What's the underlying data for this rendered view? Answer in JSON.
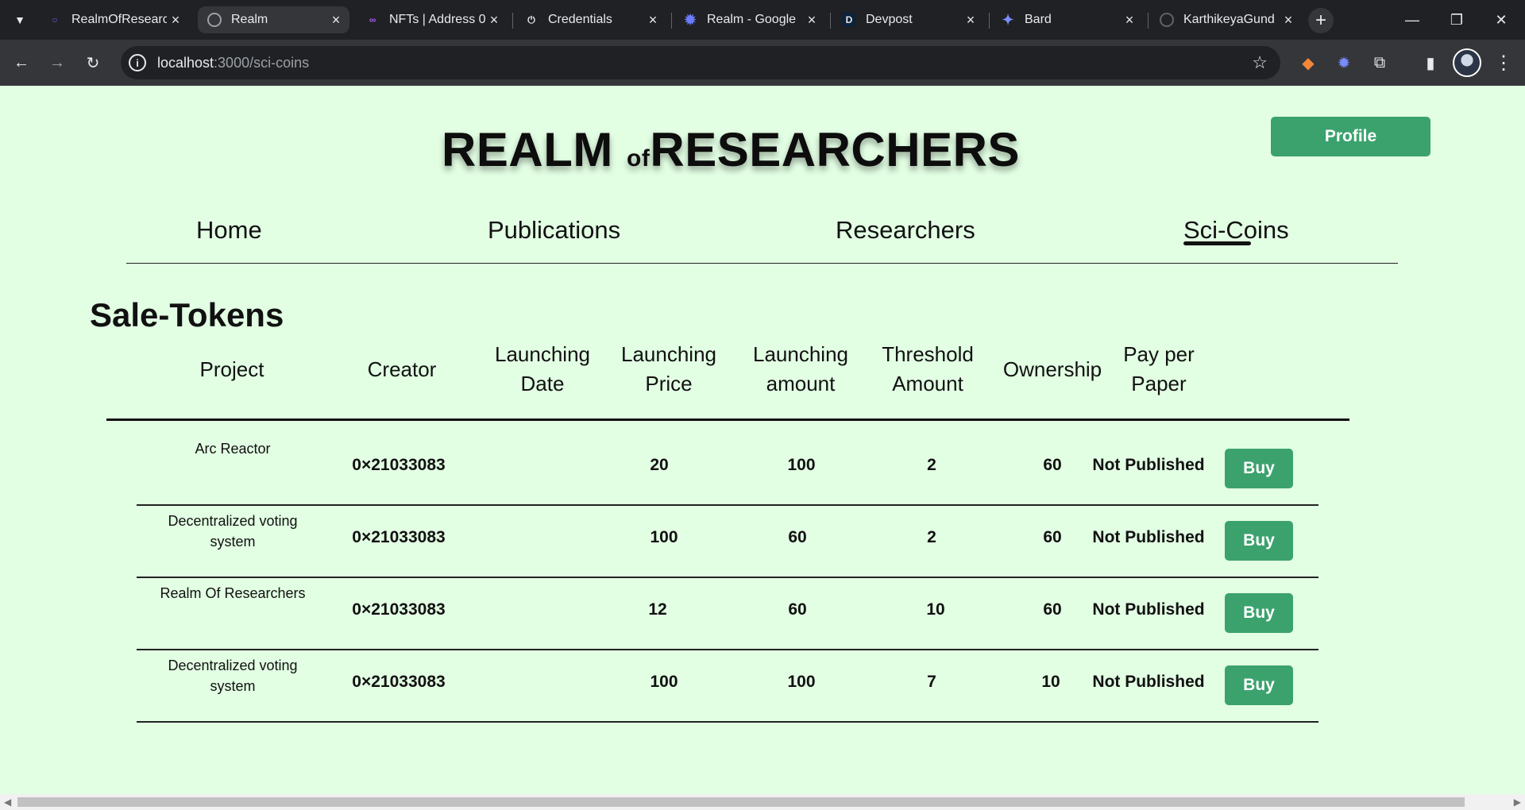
{
  "browser": {
    "tabs": [
      {
        "title": "RealmOfResearc",
        "active": false
      },
      {
        "title": "Realm",
        "active": true
      },
      {
        "title": "NFTs | Address 0",
        "active": false
      },
      {
        "title": "Credentials",
        "active": false
      },
      {
        "title": "Realm - Google",
        "active": false
      },
      {
        "title": "Devpost",
        "active": false
      },
      {
        "title": "Bard",
        "active": false
      },
      {
        "title": "KarthikeyaGund",
        "active": false
      }
    ],
    "new_tab": "+",
    "url_host": "localhost",
    "url_path": ":3000/sci-coins"
  },
  "header": {
    "brand_part1": "REALM",
    "brand_of": "of",
    "brand_part2": "RESEARCHERS",
    "profile_label": "Profile"
  },
  "nav": {
    "items": [
      "Home",
      "Publications",
      "Researchers",
      "Sci-Coins"
    ],
    "active": "Sci-Coins"
  },
  "section_title": "Sale-Tokens",
  "table": {
    "headers": [
      [
        "Project"
      ],
      [
        "Creator"
      ],
      [
        "Launching",
        "Date"
      ],
      [
        "Launching",
        "Price"
      ],
      [
        "Launching",
        "amount"
      ],
      [
        "Threshold",
        "Amount"
      ],
      [
        "Ownership"
      ],
      [
        "Pay per",
        "Paper"
      ]
    ],
    "rows": [
      {
        "project": [
          "Arc Reactor"
        ],
        "creator": "0×21033083",
        "date": "",
        "price": "20",
        "amount": "100",
        "threshold": "2",
        "ownership": "60",
        "status": "Not Published",
        "action": "Buy"
      },
      {
        "project": [
          "Decentralized voting",
          "system"
        ],
        "creator": "0×21033083",
        "date": "",
        "price": "100",
        "amount": "60",
        "threshold": "2",
        "ownership": "60",
        "status": "Not Published",
        "action": "Buy"
      },
      {
        "project": [
          "Realm Of Researchers"
        ],
        "creator": "0×21033083",
        "date": "",
        "price": "12",
        "amount": "60",
        "threshold": "10",
        "ownership": "60",
        "status": "Not Published",
        "action": "Buy"
      },
      {
        "project": [
          "Decentralized voting",
          "system"
        ],
        "creator": "0×21033083",
        "date": "",
        "price": "100",
        "amount": "100",
        "threshold": "7",
        "ownership": "10",
        "status": "Not Published",
        "action": "Buy"
      }
    ]
  },
  "colors": {
    "page_bg": "#e2fee3",
    "accent_green": "#3ba26d",
    "chrome_dark": "#202124",
    "chrome_mid": "#35363a"
  }
}
